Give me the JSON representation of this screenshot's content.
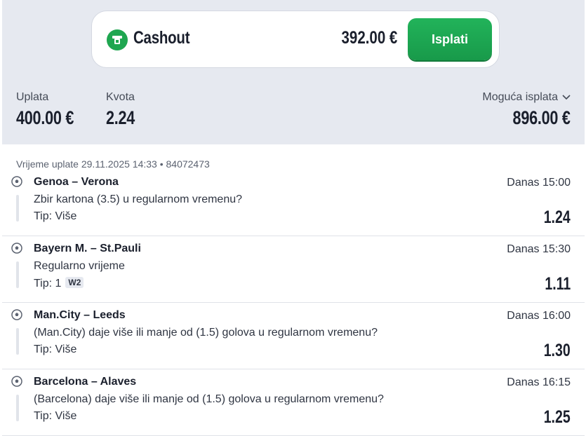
{
  "cashout": {
    "icon": "cashout-icon",
    "title": "Cashout",
    "amount": "392.00 €",
    "button": "Isplati"
  },
  "stats": {
    "uplata_label": "Uplata",
    "uplata_value": "400.00 €",
    "kvota_label": "Kvota",
    "kvota_value": "2.24",
    "payout_label": "Moguća isplata",
    "payout_value": "896.00 €"
  },
  "meta": "Vrijeme uplate 29.11.2025 14:33 • 84072473",
  "bets": [
    {
      "match": "Genoa – Verona",
      "time": "Danas 15:00",
      "market": "Zbir kartona (3.5) u regularnom vremenu?",
      "tip": "Tip: Više",
      "tag": "",
      "odd": "1.24"
    },
    {
      "match": "Bayern M. – St.Pauli",
      "time": "Danas 15:30",
      "market": "Regularno vrijeme",
      "tip": "Tip: 1",
      "tag": "W2",
      "odd": "1.11"
    },
    {
      "match": "Man.City – Leeds",
      "time": "Danas 16:00",
      "market": "(Man.City) daje više ili manje od (1.5) golova u regularnom vremenu?",
      "tip": "Tip: Više",
      "tag": "",
      "odd": "1.30"
    },
    {
      "match": "Barcelona – Alaves",
      "time": "Danas 16:15",
      "market": "(Barcelona) daje više ili manje od (1.5) golova u regularnom vremenu?",
      "tip": "Tip: Više",
      "tag": "",
      "odd": "1.25"
    }
  ]
}
